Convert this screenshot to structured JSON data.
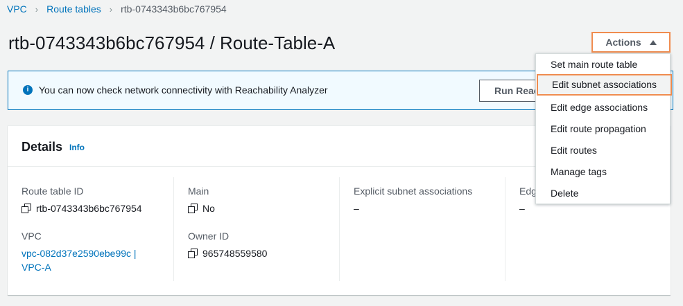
{
  "breadcrumb": {
    "items": [
      "VPC",
      "Route tables"
    ],
    "current": "rtb-0743343b6bc767954"
  },
  "page": {
    "title": "rtb-0743343b6bc767954 / Route-Table-A"
  },
  "actions": {
    "label": "Actions",
    "menu": [
      "Set main route table",
      "Edit subnet associations",
      "Edit edge associations",
      "Edit route propagation",
      "Edit routes",
      "Manage tags",
      "Delete"
    ]
  },
  "flash": {
    "icon": "info-icon",
    "message": "You can now check network connectivity with Reachability Analyzer",
    "button_label": "Run Reachability Analyzer"
  },
  "details": {
    "title": "Details",
    "info_label": "Info",
    "fields": {
      "route_table_id": {
        "label": "Route table ID",
        "value": "rtb-0743343b6bc767954"
      },
      "main": {
        "label": "Main",
        "value": "No"
      },
      "explicit_subnet": {
        "label": "Explicit subnet associations",
        "value": "–"
      },
      "edge": {
        "label": "Edge associations",
        "value": "–"
      },
      "vpc": {
        "label": "VPC",
        "value_line1": "vpc-082d37e2590ebe99c |",
        "value_line2": "VPC-A"
      },
      "owner_id": {
        "label": "Owner ID",
        "value": "965748559580"
      }
    }
  },
  "colors": {
    "link": "#0073bb",
    "highlight": "#f08c4f",
    "background": "#f2f3f3"
  }
}
